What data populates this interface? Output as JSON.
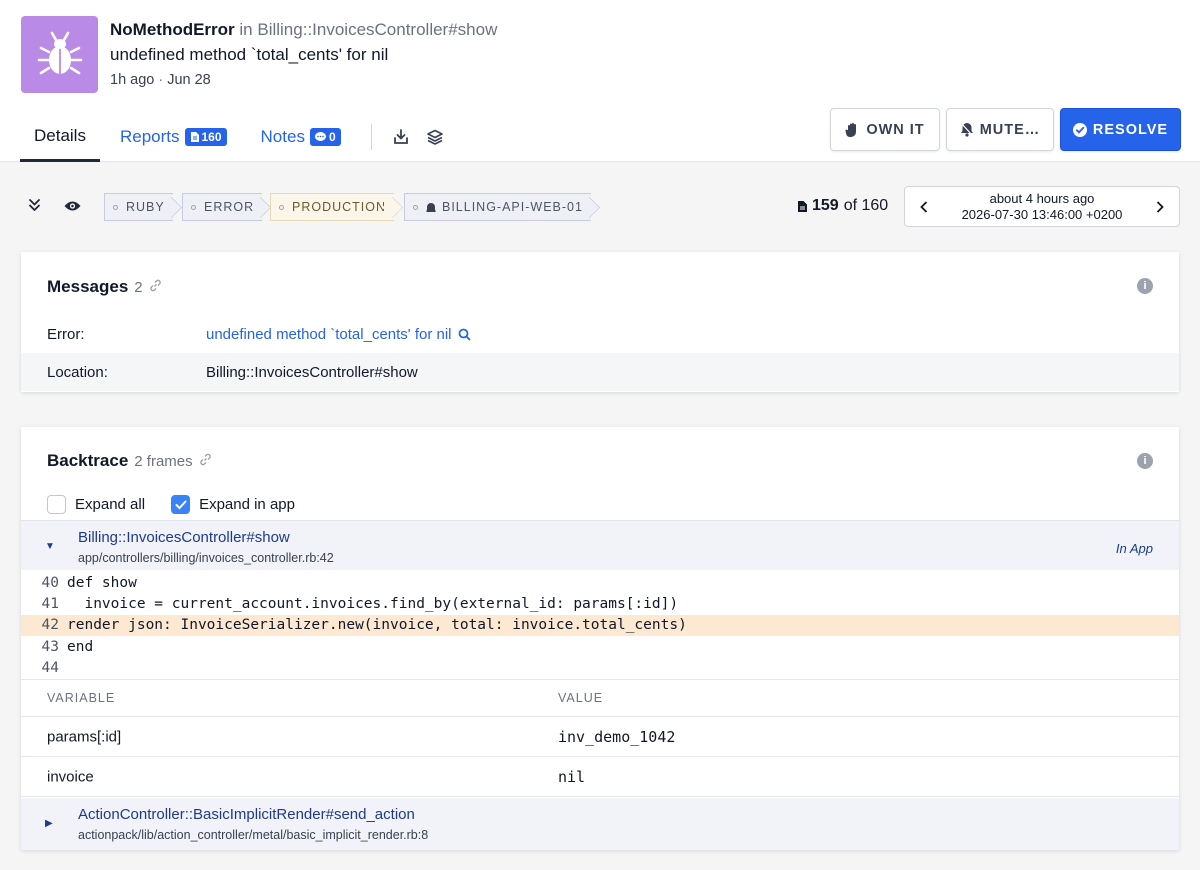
{
  "header": {
    "error_class": "NoMethodError",
    "location_prefix": "in Billing::InvoicesController#show",
    "message": "undefined method `total_cents' for nil",
    "time_ago": "1h ago",
    "date": "Jun 28",
    "icon": "bug-icon",
    "icon_bg": "#b98ae6"
  },
  "tabs": {
    "details": "Details",
    "reports": "Reports",
    "reports_count": "160",
    "notes": "Notes",
    "notes_count": "0"
  },
  "actions": {
    "own": "OWN IT",
    "mute": "MUTE…",
    "resolve": "RESOLVE",
    "resolve_color": "#2563eb"
  },
  "tags": {
    "lang": "RUBY",
    "severity": "ERROR",
    "env": "PRODUCTION",
    "host": "BILLING-API-WEB-01"
  },
  "notice_nav": {
    "current": "159",
    "of_label": "of 160",
    "relative": "about 4 hours ago",
    "timestamp": "2026-07-30 13:46:00 +0200"
  },
  "messages": {
    "title": "Messages",
    "count": "2",
    "error_label": "Error:",
    "error_value": "undefined method `total_cents' for nil",
    "location_label": "Location:",
    "location_value": "Billing::InvoicesController#show"
  },
  "backtrace": {
    "title": "Backtrace",
    "count": "2 frames",
    "expand_all": "Expand all",
    "expand_in_app": "Expand in app",
    "frames": [
      {
        "method": "Billing::InvoicesController#show",
        "file": "app/controllers/billing/invoices_controller.rb:42",
        "in_app": "In App",
        "code": [
          {
            "line": "40",
            "text": "def show"
          },
          {
            "line": "41",
            "text": "  invoice = current_account.invoices.find_by(external_id: params[:id])"
          },
          {
            "line": "42",
            "text": "render json: InvoiceSerializer.new(invoice, total: invoice.total_cents)"
          },
          {
            "line": "43",
            "text": "end"
          },
          {
            "line": "44",
            "text": ""
          }
        ],
        "vars_header": {
          "variable": "VARIABLE",
          "value": "VALUE"
        },
        "vars": [
          {
            "name": "params[:id]",
            "value": "inv_demo_1042"
          },
          {
            "name": "invoice",
            "value": "nil"
          }
        ]
      },
      {
        "method": "ActionController::BasicImplicitRender#send_action",
        "file": "actionpack/lib/action_controller/metal/basic_implicit_render.rb:8"
      }
    ]
  }
}
